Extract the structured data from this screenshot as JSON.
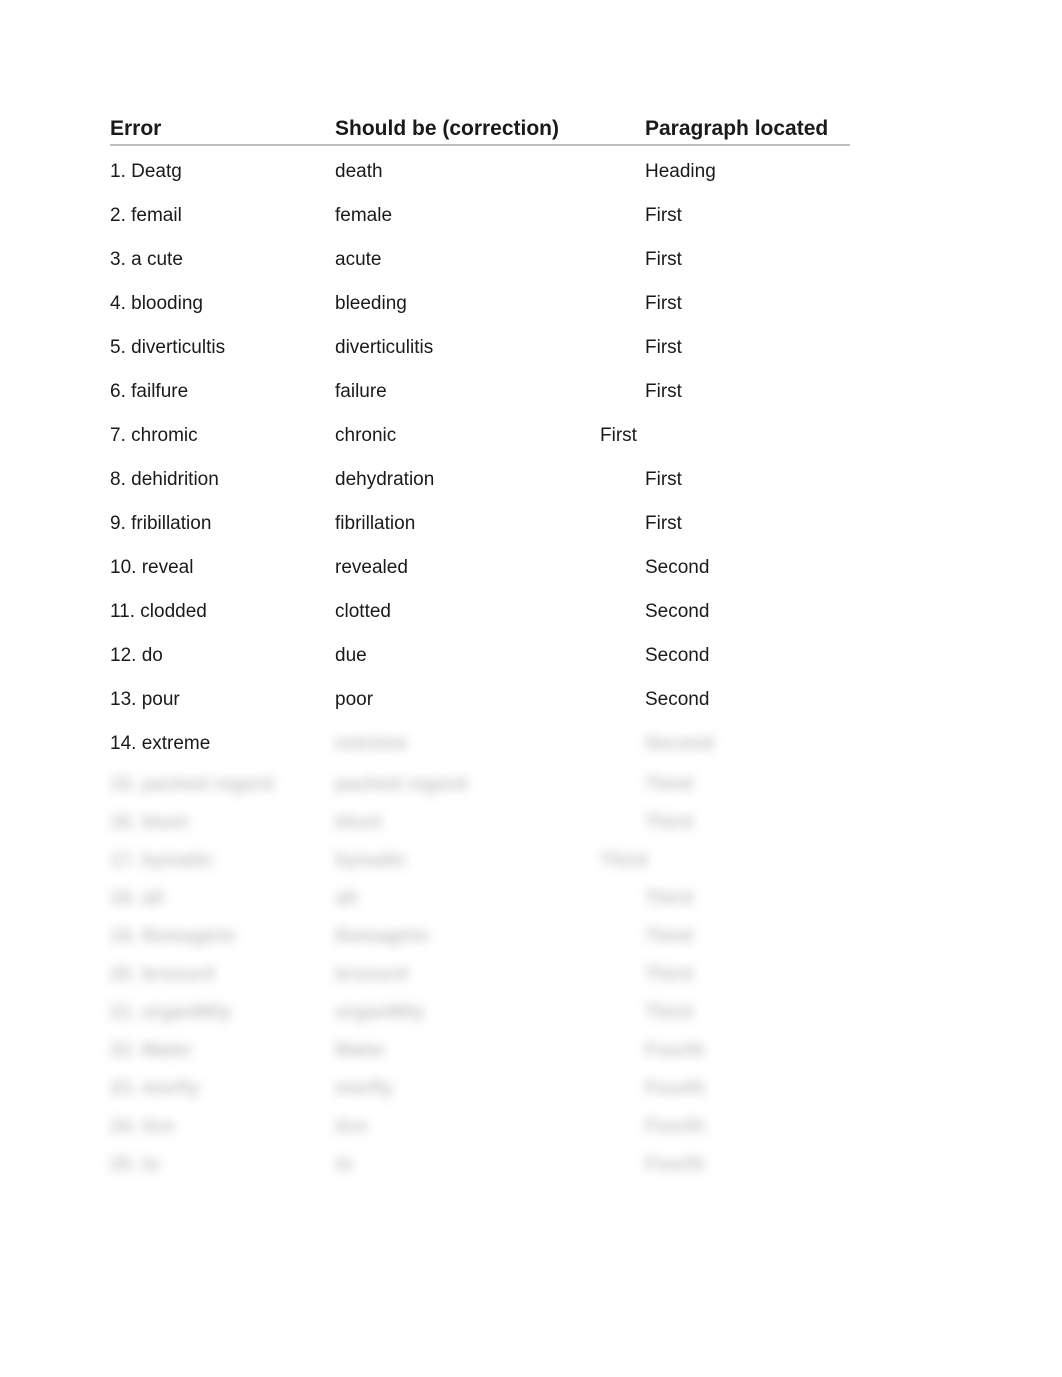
{
  "headers": {
    "error": "Error",
    "correction": "Should be (correction)",
    "location": "Paragraph located"
  },
  "rows": [
    {
      "error": "1. Deatg",
      "correction": "death",
      "location": "Heading",
      "blurred": false,
      "shift": false
    },
    {
      "error": "2. femail",
      "correction": "female",
      "location": "First",
      "blurred": false,
      "shift": false
    },
    {
      "error": "3. a cute",
      "correction": "acute",
      "location": "First",
      "blurred": false,
      "shift": false
    },
    {
      "error": "4. blooding",
      "correction": "bleeding",
      "location": "First",
      "blurred": false,
      "shift": false
    },
    {
      "error": "5. diverticultis",
      "correction": "diverticulitis",
      "location": "First",
      "blurred": false,
      "shift": false
    },
    {
      "error": "6. failfure",
      "correction": "failure",
      "location": "First",
      "blurred": false,
      "shift": false
    },
    {
      "error": "7. chromic",
      "correction": "chronic",
      "location": "First",
      "blurred": false,
      "shift": true
    },
    {
      "error": "8. dehidrition",
      "correction": "dehydration",
      "location": "First",
      "blurred": false,
      "shift": false
    },
    {
      "error": "9. fribillation",
      "correction": "fibrillation",
      "location": "First",
      "blurred": false,
      "shift": false
    },
    {
      "error": "10. reveal",
      "correction": "revealed",
      "location": "Second",
      "blurred": false,
      "shift": false
    },
    {
      "error": "11. clodded",
      "correction": "clotted",
      "location": "Second",
      "blurred": false,
      "shift": false
    },
    {
      "error": "12. do",
      "correction": "due",
      "location": "Second",
      "blurred": false,
      "shift": false
    },
    {
      "error": "13. pour",
      "correction": "poor",
      "location": "Second",
      "blurred": false,
      "shift": false
    },
    {
      "error": "14. extreme",
      "correction": "extreme",
      "location": "Second",
      "blurred": "partial",
      "shift": false
    },
    {
      "error": "15. pached regord",
      "correction": "pached regord",
      "location": "Third",
      "blurred": true,
      "shift": false,
      "tight": true
    },
    {
      "error": "16. blunt",
      "correction": "blunt",
      "location": "Third",
      "blurred": true,
      "shift": false,
      "tight": true
    },
    {
      "error": "17. bynadic",
      "correction": "bynadic",
      "location": "Third",
      "blurred": true,
      "shift": true,
      "tight": true
    },
    {
      "error": "18. alt",
      "correction": "alt",
      "location": "Third",
      "blurred": true,
      "shift": false,
      "tight": true
    },
    {
      "error": "19. Remagtrin",
      "correction": "Remagtrin",
      "location": "Third",
      "blurred": true,
      "shift": false,
      "tight": true
    },
    {
      "error": "20. bronurd",
      "correction": "bronurd",
      "location": "Third",
      "blurred": true,
      "shift": false,
      "tight": true
    },
    {
      "error": "21. organMily",
      "correction": "organMily",
      "location": "Third",
      "blurred": true,
      "shift": false,
      "tight": true
    },
    {
      "error": "22. Mater",
      "correction": "Mater",
      "location": "Fourth",
      "blurred": true,
      "shift": false,
      "tight": true
    },
    {
      "error": "23. morfiy",
      "correction": "morfly",
      "location": "Fourth",
      "blurred": true,
      "shift": false,
      "tight": true
    },
    {
      "error": "24. tice",
      "correction": "tice",
      "location": "Fourth",
      "blurred": true,
      "shift": false,
      "tight": true
    },
    {
      "error": "25. to",
      "correction": "to",
      "location": "Fourth",
      "blurred": true,
      "shift": false,
      "tight": true
    }
  ]
}
